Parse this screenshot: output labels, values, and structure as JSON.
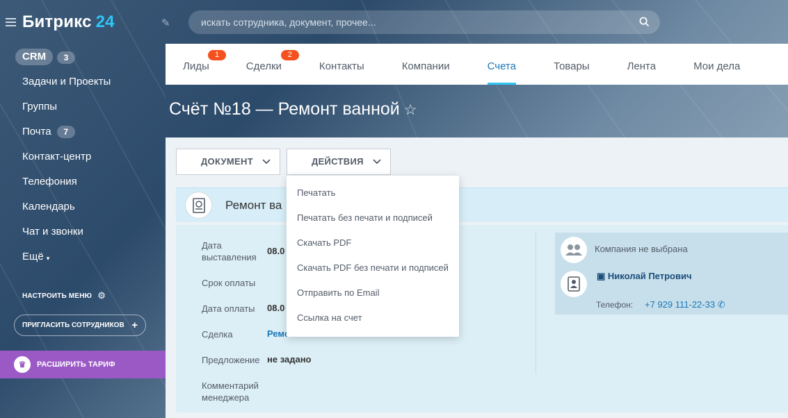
{
  "app": {
    "logo_main": "Битрикс",
    "logo_num": "24"
  },
  "search": {
    "placeholder": "искать сотрудника, документ, прочее..."
  },
  "sidebar": {
    "crm_label": "CRM",
    "crm_badge": "3",
    "items": [
      {
        "label": "Задачи и Проекты"
      },
      {
        "label": "Группы"
      },
      {
        "label": "Почта",
        "badge": "7"
      },
      {
        "label": "Контакт-центр"
      },
      {
        "label": "Телефония"
      },
      {
        "label": "Календарь"
      },
      {
        "label": "Чат и звонки"
      },
      {
        "label": "Ещё"
      }
    ],
    "configure_label": "НАСТРОИТЬ МЕНЮ",
    "invite_label": "ПРИГЛАСИТЬ СОТРУДНИКОВ",
    "tariff_label": "РАСШИРИТЬ ТАРИФ"
  },
  "tabs": [
    {
      "label": "Лиды",
      "badge": "1"
    },
    {
      "label": "Сделки",
      "badge": "2"
    },
    {
      "label": "Контакты"
    },
    {
      "label": "Компании"
    },
    {
      "label": "Счета",
      "active": true
    },
    {
      "label": "Товары"
    },
    {
      "label": "Лента"
    },
    {
      "label": "Мои дела"
    }
  ],
  "page": {
    "title": "Счёт №18 — Ремонт ванной"
  },
  "toolbar": {
    "document_label": "ДОКУМЕНТ",
    "actions_label": "ДЕЙСТВИЯ"
  },
  "entity": {
    "title": "Ремонт ва"
  },
  "fields": {
    "issue_date_label": "Дата выставления",
    "issue_date_value": "08.0",
    "due_label": "Срок оплаты",
    "paid_label": "Дата оплаты",
    "paid_value": "08.0",
    "deal_label": "Сделка",
    "deal_value": "Ремонт ванной",
    "offer_label": "Предложение",
    "offer_value": "не задано",
    "comment_label": "Комментарий менеджера"
  },
  "client": {
    "company": "Компания не выбрана",
    "contact": "Николай Петрович",
    "phone_label": "Телефон:",
    "phone": "+7 929 111-22-33"
  },
  "actions_menu": [
    "Печатать",
    "Печатать без печати и подписей",
    "Скачать PDF",
    "Скачать PDF без печати и подписей",
    "Отправить по Email",
    "Ссылка на счет"
  ],
  "colors": {
    "accent": "#2fc6f6",
    "badge": "#f4511e",
    "tariff": "#9b59c6",
    "link": "#1a77b8"
  }
}
